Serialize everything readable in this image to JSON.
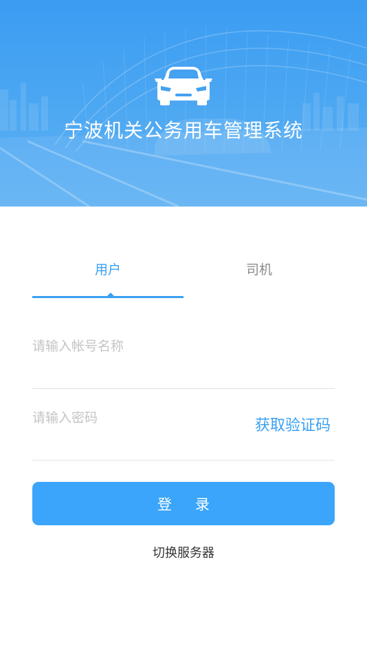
{
  "header": {
    "title": "宁波机关公务用车管理系统",
    "icon": "car-icon",
    "background_color": "#3b9cf2"
  },
  "tabs": [
    {
      "label": "用户",
      "active": true
    },
    {
      "label": "司机",
      "active": false
    }
  ],
  "form": {
    "account_placeholder": "请输入帐号名称",
    "account_value": "",
    "password_placeholder": "请输入密码",
    "password_value": "",
    "get_code_label": "获取验证码",
    "login_label": "登录",
    "switch_server_label": "切换服务器"
  },
  "colors": {
    "accent": "#3aa0f2",
    "button": "#3aa5fb",
    "inactive_tab": "#8a8a8a",
    "placeholder": "#c4c4c4"
  }
}
